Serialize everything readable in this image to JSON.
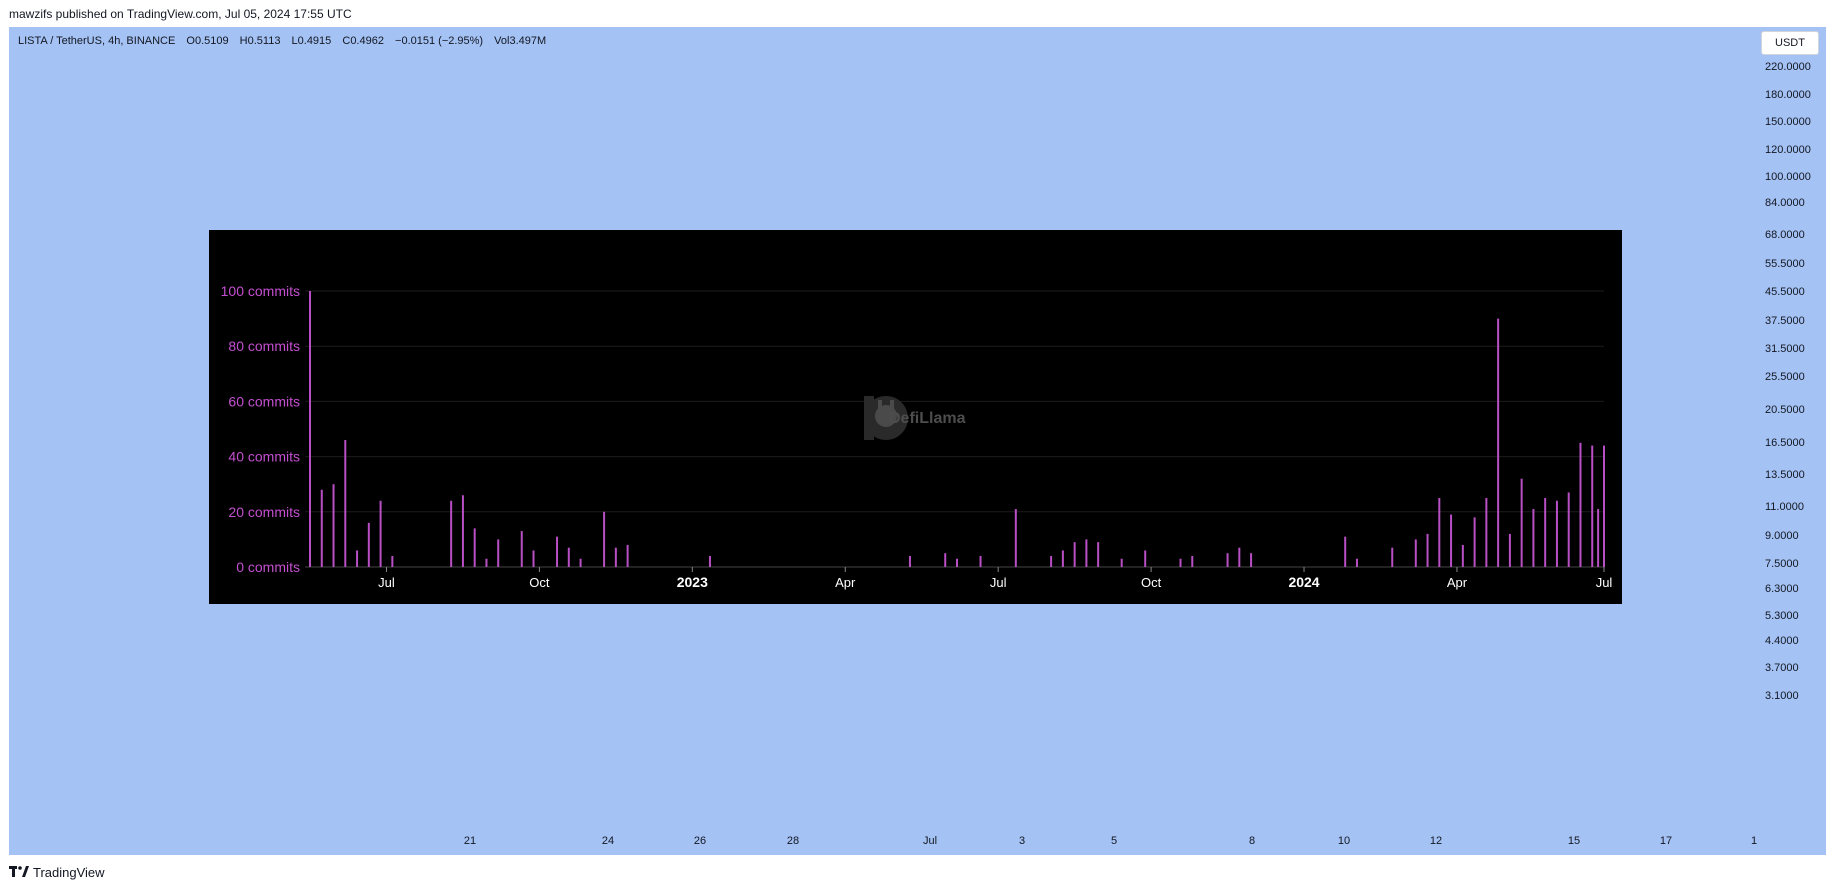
{
  "caption": "mawzifs published on TradingView.com, Jul 05, 2024 17:55 UTC",
  "symbol": {
    "name": "LISTA / TetherUS, 4h, BINANCE",
    "open_label": "O",
    "open": "0.5109",
    "high_label": "H",
    "high": "0.5113",
    "low_label": "L",
    "low": "0.4915",
    "close_label": "C",
    "close": "0.4962",
    "change": "−0.0151 (−2.95%)",
    "vol_label": "Vol",
    "vol": "3.497M"
  },
  "currency_button": "USDT",
  "price_scale": [
    "220.0000",
    "180.0000",
    "150.0000",
    "120.0000",
    "100.0000",
    "84.0000",
    "68.0000",
    "55.5000",
    "45.5000",
    "37.5000",
    "31.5000",
    "25.5000",
    "20.5000",
    "16.5000",
    "13.5000",
    "11.0000",
    "9.0000",
    "7.5000",
    "6.3000",
    "5.3000",
    "4.4000",
    "3.7000",
    "3.1000"
  ],
  "time_scale": [
    "21",
    "24",
    "26",
    "28",
    "Jul",
    "3",
    "5",
    "8",
    "10",
    "12",
    "15",
    "17",
    "1"
  ],
  "watermark": "DefiLlama",
  "branding": "TradingView",
  "colors": {
    "pane": "#a4c2f4",
    "chart_bg": "#000000",
    "bar": "#b94fc4",
    "ylabel": "#c44fd0",
    "xlabel": "#ffffff"
  },
  "chart_data": {
    "type": "bar",
    "unit": "commits",
    "y_ticks": [
      "100 commits",
      "80 commits",
      "60 commits",
      "40 commits",
      "20 commits",
      "0 commits"
    ],
    "y_tick_values": [
      100,
      80,
      60,
      40,
      20,
      0
    ],
    "ylim": [
      0,
      100
    ],
    "x_ticks": [
      "Jul",
      "Oct",
      "2023",
      "Apr",
      "Jul",
      "Oct",
      "2024",
      "Apr",
      "Jul"
    ],
    "x_tick_bold": [
      false,
      false,
      true,
      false,
      false,
      false,
      true,
      false,
      false
    ],
    "xlim_weeks": [
      0,
      110
    ],
    "x_tick_weeks": [
      6.5,
      19.5,
      32.5,
      45.5,
      58.5,
      71.5,
      84.5,
      97.5,
      110
    ],
    "bars": [
      {
        "week": 0,
        "value": 100
      },
      {
        "week": 1,
        "value": 28
      },
      {
        "week": 2,
        "value": 30
      },
      {
        "week": 3,
        "value": 46
      },
      {
        "week": 4,
        "value": 6
      },
      {
        "week": 5,
        "value": 16
      },
      {
        "week": 6,
        "value": 24
      },
      {
        "week": 7,
        "value": 4
      },
      {
        "week": 12,
        "value": 24
      },
      {
        "week": 13,
        "value": 26
      },
      {
        "week": 14,
        "value": 14
      },
      {
        "week": 15,
        "value": 3
      },
      {
        "week": 16,
        "value": 10
      },
      {
        "week": 18,
        "value": 13
      },
      {
        "week": 19,
        "value": 6
      },
      {
        "week": 21,
        "value": 11
      },
      {
        "week": 22,
        "value": 7
      },
      {
        "week": 23,
        "value": 3
      },
      {
        "week": 25,
        "value": 20
      },
      {
        "week": 26,
        "value": 7
      },
      {
        "week": 27,
        "value": 8
      },
      {
        "week": 34,
        "value": 4
      },
      {
        "week": 51,
        "value": 4
      },
      {
        "week": 54,
        "value": 5
      },
      {
        "week": 55,
        "value": 3
      },
      {
        "week": 57,
        "value": 4
      },
      {
        "week": 60,
        "value": 21
      },
      {
        "week": 63,
        "value": 4
      },
      {
        "week": 64,
        "value": 6
      },
      {
        "week": 65,
        "value": 9
      },
      {
        "week": 66,
        "value": 10
      },
      {
        "week": 67,
        "value": 9
      },
      {
        "week": 69,
        "value": 3
      },
      {
        "week": 71,
        "value": 6
      },
      {
        "week": 74,
        "value": 3
      },
      {
        "week": 75,
        "value": 4
      },
      {
        "week": 78,
        "value": 5
      },
      {
        "week": 79,
        "value": 7
      },
      {
        "week": 80,
        "value": 5
      },
      {
        "week": 88,
        "value": 11
      },
      {
        "week": 89,
        "value": 3
      },
      {
        "week": 92,
        "value": 7
      },
      {
        "week": 94,
        "value": 10
      },
      {
        "week": 95,
        "value": 12
      },
      {
        "week": 96,
        "value": 25
      },
      {
        "week": 97,
        "value": 19
      },
      {
        "week": 98,
        "value": 8
      },
      {
        "week": 99,
        "value": 18
      },
      {
        "week": 100,
        "value": 25
      },
      {
        "week": 101,
        "value": 90
      },
      {
        "week": 102,
        "value": 12
      },
      {
        "week": 103,
        "value": 32
      },
      {
        "week": 104,
        "value": 21
      },
      {
        "week": 105,
        "value": 25
      },
      {
        "week": 106,
        "value": 24
      },
      {
        "week": 107,
        "value": 27
      },
      {
        "week": 108,
        "value": 45
      },
      {
        "week": 109,
        "value": 44
      },
      {
        "week": 109.5,
        "value": 21
      },
      {
        "week": 110,
        "value": 44
      }
    ]
  }
}
